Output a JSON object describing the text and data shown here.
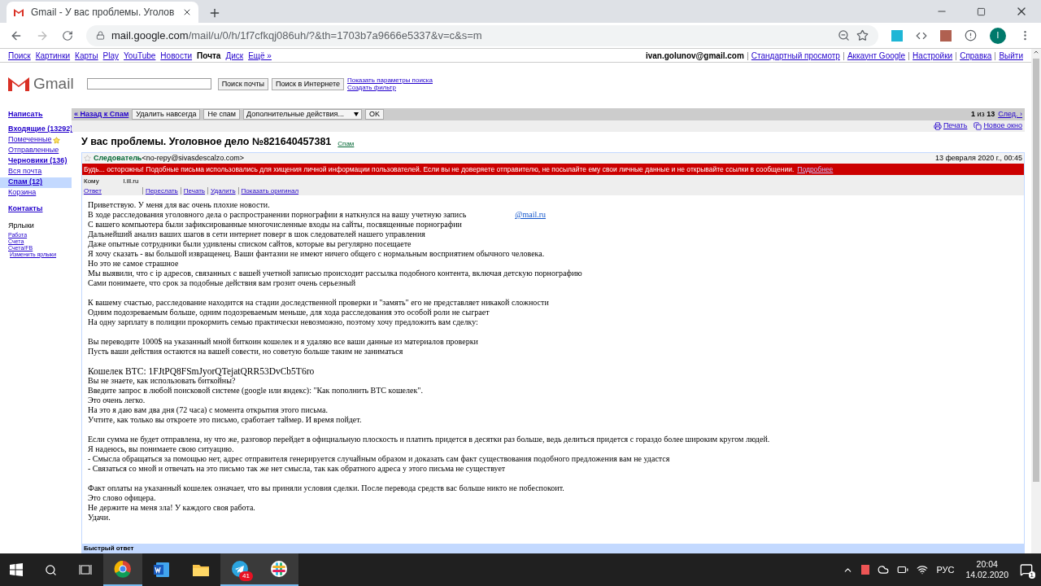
{
  "browser": {
    "tab_title": "Gmail - У вас проблемы. Уголов",
    "url_host": "mail.google.com",
    "url_path": "/mail/u/0/h/1f7cfkqj086uh/?&th=1703b7a9666e5337&v=c&s=m",
    "avatar_letter": "I"
  },
  "google_bar": {
    "links": [
      {
        "label": "Поиск",
        "selected": false
      },
      {
        "label": "Картинки",
        "selected": false
      },
      {
        "label": "Карты",
        "selected": false
      },
      {
        "label": "Play",
        "selected": false
      },
      {
        "label": "YouTube",
        "selected": false
      },
      {
        "label": "Новости",
        "selected": false
      },
      {
        "label": "Почта",
        "selected": true
      },
      {
        "label": "Диск",
        "selected": false
      },
      {
        "label": "Ещё »",
        "selected": false
      }
    ],
    "account": "ivan.golunov@gmail.com",
    "account_links": [
      "Стандартный просмотр",
      "Аккаунт Google",
      "Настройки",
      "Справка",
      "Выйти"
    ]
  },
  "header": {
    "logo": "Gmail",
    "search_mail": "Поиск почты",
    "search_web": "Поиск в Интернете",
    "options_links": [
      "Показать параметры поиска",
      "Создать фильтр"
    ]
  },
  "sidebar": {
    "compose": "Написать",
    "items": [
      {
        "label": "Входящие (13292)",
        "bold": true,
        "selected": false,
        "starred": false
      },
      {
        "label": "Помеченные",
        "bold": false,
        "selected": false,
        "starred": true
      },
      {
        "label": "Отправленные",
        "bold": false,
        "selected": false,
        "starred": false
      },
      {
        "label": "Черновики (136)",
        "bold": true,
        "selected": false,
        "starred": false
      },
      {
        "label": "Вся почта",
        "bold": false,
        "selected": false,
        "starred": false
      },
      {
        "label": "Спам (12)",
        "bold": true,
        "selected": true,
        "starred": false
      },
      {
        "label": "Корзина",
        "bold": false,
        "selected": false,
        "starred": false
      }
    ],
    "contacts": "Контакты",
    "labels_title": "Ярлыки",
    "labels": [
      "Работа",
      "Счета",
      "Счета/FB"
    ],
    "edit_labels": "Изменить ярлыки"
  },
  "toolbar": {
    "back": "« Назад к Спам",
    "buttons": [
      "Удалить навсегда",
      "Не спам"
    ],
    "more_actions": "Дополнительные действия...",
    "ok": "OK",
    "page_current": "1",
    "page_of": "из",
    "page_total": "13",
    "next": "След. ›",
    "print": "Печать",
    "new_window": "Новое окно"
  },
  "message": {
    "subject": "У вас проблемы. Уголовное дело №821640457381",
    "label": "Спам",
    "sender": "Следователь",
    "sender_address": "<no-repy@sivasdescalzo.com>",
    "date": "13 февраля 2020 г., 00:45",
    "warning": "Будь... осторожны! Подобные письма использовались для хищения личной информации пользователей. Если вы не доверяете отправителю, не посылайте ему свои личные данные и не открывайте ссылки в сообщении.",
    "warning_link": "Подробнее",
    "to_label": "Кому",
    "to_value": "l.ill.ru",
    "actions": [
      "Ответ",
      "Переслать",
      "Печать",
      "Удалить",
      "Показать оригинал"
    ],
    "paragraphs": [
      [
        {
          "text": "Приветствую. У меня для вас очень плохие новости."
        },
        {
          "text": "В ходе расследования уголовного дела о распространении порнографии я наткнулся на вашу учетную запись",
          "link": "@mail.ru"
        },
        {
          "text": "С вашего компьютера были зафиксированные многочисленные входы на сайты, посвященные порнографии"
        },
        {
          "text": "Дальнейший анализ ваших шагов в сети интернет поверг в шок следователей нашего управления"
        },
        {
          "text": "Даже опытные сотрудники были удивлены списком сайтов, которые вы регулярно посещаете"
        },
        {
          "text": "Я хочу сказать - вы большой извращенец. Ваши фантазии не имеют ничего общего с нормальным восприятием обычного человека."
        },
        {
          "text": "Но это не самое страшное"
        },
        {
          "text": "Мы выявили, что с ip адресов, связанных с вашей учетной записью происходит рассылка подобного контента, включая детскую порнографию"
        },
        {
          "text": "Сами понимаете, что срок за подобные действия вам грозит очень серьезный"
        }
      ],
      [
        {
          "text": "К вашему счастью, расследование находится на стадии доследственной проверки и \"замять\" его не представляет никакой сложности"
        },
        {
          "text": "Одним подозреваемым больше, одним подозреваемым меньше, для хода расследования это особой роли не сыграет"
        },
        {
          "text": "На одну зарплату в полиции прокормить семью практически невозможно, поэтому хочу предложить вам сделку:"
        }
      ],
      [
        {
          "text": "Вы переводите 1000$ на указанный мной биткоин кошелек и я удаляю все ваши данные из материалов проверки"
        },
        {
          "text": "Пусть ваши действия остаются на вашей совести, но советую больше таким не заниматься"
        }
      ],
      [
        {
          "text": "Кошелек BTC:  1FJtPQ8FSmJyorQTejatQRR53DvCb5T6ro",
          "large": true
        },
        {
          "text": "Вы не знаете, как использовать биткойны?"
        },
        {
          "text": "Введите запрос в любой поисковой системе (google или яндекс): \"Как пополнить BTC кошелек\"."
        },
        {
          "text": "Это очень легко."
        },
        {
          "text": "На это я даю вам два дня (72 часа) с момента открытия этого письма."
        },
        {
          "text": "Учтите, как только вы откроете это письмо, сработает таймер. И время пойдет."
        }
      ],
      [
        {
          "text": "Если сумма не будет отправлена, ну что же, разговор перейдет в официальную плоскость и платить придется в десятки раз больше, ведь делиться придется с гораздо более широким кругом людей."
        },
        {
          "text": "Я надеюсь, вы понимаете свою ситуацию."
        },
        {
          "text": "- Смысла обращаться за помощью нет, адрес отправителя генерируется случайным образом и доказать сам факт существования подобного предложения вам не удастся"
        },
        {
          "text": "- Связаться со мной и отвечать на это письмо так же нет смысла, так как обратного адреса у этого письма не существует"
        }
      ],
      [
        {
          "text": "Факт оплаты на указанный кошелек означает, что вы приняли условия сделки. После перевода средств вас больше никто не побеспокоит."
        },
        {
          "text": "Это слово офицера."
        },
        {
          "text": "Не держите на меня зла! У каждого своя работа."
        },
        {
          "text": "Удачи."
        }
      ]
    ],
    "quick_reply": "Быстрый ответ"
  },
  "taskbar": {
    "apps": [
      {
        "kind": "chrome",
        "active": true
      },
      {
        "kind": "word",
        "active": false
      },
      {
        "kind": "folder",
        "active": false
      },
      {
        "kind": "telegram",
        "active": true,
        "badge": "41"
      },
      {
        "kind": "slack",
        "active": true
      }
    ],
    "language": "РУС",
    "time": "20:04",
    "date": "14.02.2020",
    "notifications": "1"
  }
}
